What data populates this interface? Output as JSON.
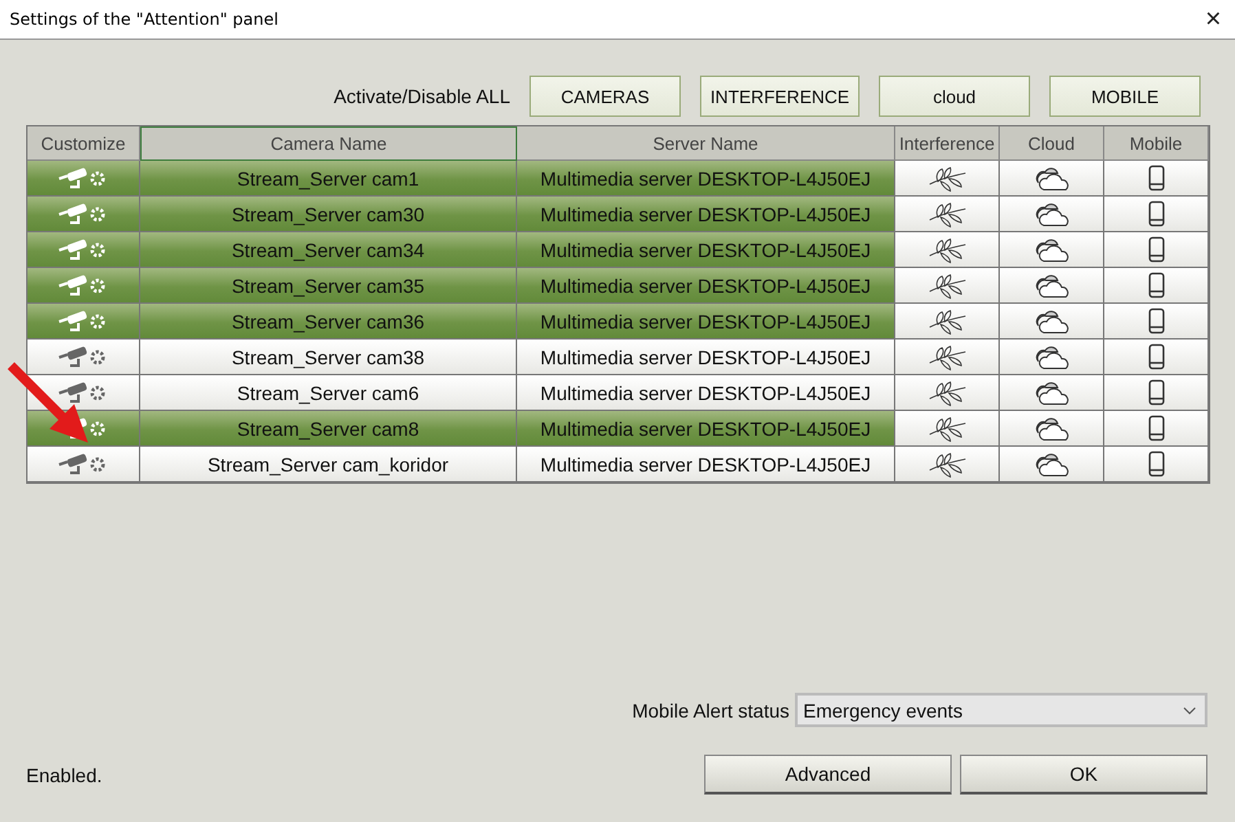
{
  "window": {
    "title": "Settings of the \"Attention\" panel",
    "close": "×"
  },
  "toggle_all": {
    "label": "Activate/Disable ALL",
    "buttons": [
      "CAMERAS",
      "INTERFERENCE",
      "cloud",
      "MOBILE"
    ]
  },
  "table": {
    "columns": [
      "Customize",
      "Camera Name",
      "Server Name",
      "Interference",
      "Cloud",
      "Mobile"
    ],
    "rows": [
      {
        "camera": "Stream_Server cam1",
        "server": "Multimedia server DESKTOP-L4J50EJ",
        "active": true
      },
      {
        "camera": "Stream_Server cam30",
        "server": "Multimedia server DESKTOP-L4J50EJ",
        "active": true
      },
      {
        "camera": "Stream_Server cam34",
        "server": "Multimedia server DESKTOP-L4J50EJ",
        "active": true
      },
      {
        "camera": "Stream_Server cam35",
        "server": "Multimedia server DESKTOP-L4J50EJ",
        "active": true
      },
      {
        "camera": "Stream_Server cam36",
        "server": "Multimedia server DESKTOP-L4J50EJ",
        "active": true
      },
      {
        "camera": "Stream_Server cam38",
        "server": "Multimedia server DESKTOP-L4J50EJ",
        "active": false
      },
      {
        "camera": "Stream_Server cam6",
        "server": "Multimedia server DESKTOP-L4J50EJ",
        "active": false
      },
      {
        "camera": "Stream_Server cam8",
        "server": "Multimedia server DESKTOP-L4J50EJ",
        "active": true
      },
      {
        "camera": "Stream_Server cam_koridor",
        "server": "Multimedia server DESKTOP-L4J50EJ",
        "active": false
      }
    ]
  },
  "mobile_alert": {
    "label": "Mobile Alert status",
    "value": "Emergency events"
  },
  "status": "Enabled.",
  "buttons": [
    "Advanced",
    "OK"
  ]
}
